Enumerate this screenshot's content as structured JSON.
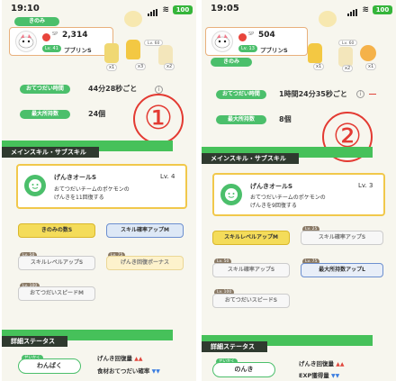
{
  "left": {
    "status_time": "19:10",
    "battery": "100",
    "top_pill": "きのみ",
    "pokemon_sp": "2,314",
    "pokemon_level": "Lv. 41",
    "pokemon_name": "プブリンS",
    "items": [
      {
        "count": "x1"
      },
      {
        "count": "x3"
      },
      {
        "count": "x2"
      }
    ],
    "item_lv": "Lv. 60",
    "help_label": "おてつだい時間",
    "help_value": "44分28秒ごと",
    "max_label": "最大所持数",
    "max_value": "24個",
    "circle_num": "①",
    "section_skill": "メインスキル・サブスキル",
    "skill_name": "げんきオールS",
    "skill_level": "Lv. 4",
    "skill_desc_1": "おてつだいチームのポケモンの",
    "skill_desc_2": "げんきを11回復する",
    "sub_buttons": [
      {
        "label": "きのみの数S",
        "lv": ""
      },
      {
        "label": "スキル確率アップM",
        "lv": ""
      },
      {
        "label": "スキルレベルアップS",
        "lv": "Lv. 50"
      },
      {
        "label": "げんき回復ボーナス",
        "lv": "Lv. 75"
      },
      {
        "label": "おてつだいスピードM",
        "lv": "Lv. 100"
      }
    ],
    "section_detail": "詳細ステータス",
    "nature_label": "せいかく",
    "nature_value": "わんぱく",
    "effect_1": "げんき回復量",
    "effect_2": "食材おてつだい確率"
  },
  "right": {
    "status_time": "19:05",
    "battery": "100",
    "pokemon_sp": "504",
    "pokemon_level": "Lv. 13",
    "pokemon_name": "プブリンS",
    "top_pill_2": "きのみ",
    "top_pill_3": "食材",
    "items": [
      {
        "count": "x1"
      },
      {
        "count": "x2"
      },
      {
        "count": "x1"
      }
    ],
    "item_lv": "Lv. 60",
    "help_label": "おてつだい時間",
    "help_value": "1時間24分35秒ごと",
    "max_label": "最大所持数",
    "max_value": "8個",
    "circle_num": "②",
    "section_skill": "メインスキル・サブスキル",
    "skill_name": "げんきオールS",
    "skill_level": "Lv. 3",
    "skill_desc_1": "おてつだいチームのポケモンの",
    "skill_desc_2": "げんきを9回復する",
    "sub_buttons": [
      {
        "label": "スキルレベルアップM",
        "lv": ""
      },
      {
        "label": "スキル確率アップS",
        "lv": "Lv. 25"
      },
      {
        "label": "スキル確率アップS",
        "lv": "Lv. 50"
      },
      {
        "label": "最大所持数アップL",
        "lv": "Lv. 75"
      },
      {
        "label": "おてつだいスピードS",
        "lv": "Lv. 100"
      }
    ],
    "section_detail": "詳細ステータス",
    "nature_label": "せいかく",
    "nature_value": "のんき",
    "effect_1": "げんき回復量",
    "effect_2": "EXP獲得量"
  }
}
